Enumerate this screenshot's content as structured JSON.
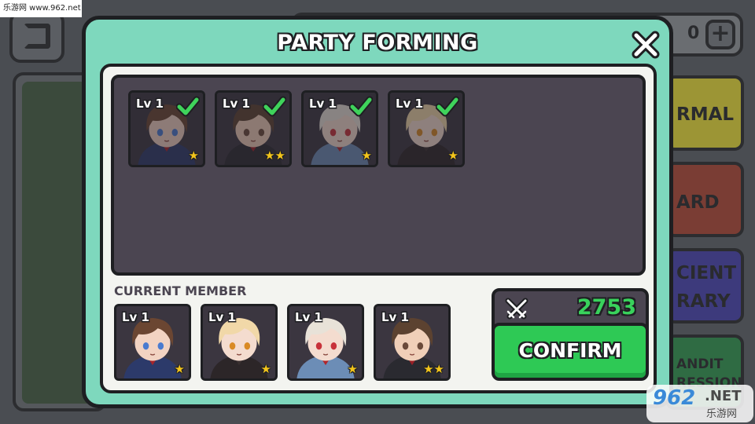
{
  "watermark": {
    "top_text": "乐游网 www.962.net",
    "bottom_number": "962",
    "bottom_net": ".NET",
    "bottom_cn": "乐游网"
  },
  "background": {
    "coin_count": "0",
    "plus_label": "+",
    "modes": [
      {
        "label": "RMAL"
      },
      {
        "label": "ARD"
      },
      {
        "label": "CIENT\nRARY"
      },
      {
        "label": "ANDIT\nRESSION"
      }
    ]
  },
  "modal": {
    "title": "PARTY FORMING",
    "roster": [
      {
        "level": "Lv 1",
        "stars": "★",
        "selected": true,
        "hair": "#6b4632",
        "skin": "#f2d3c2",
        "eye": "#4a7bd0",
        "accent": "#a6242a",
        "outfit": "#2c3a6a"
      },
      {
        "level": "Lv 1",
        "stars": "★★",
        "selected": true,
        "hair": "#5c4230",
        "skin": "#f0cfb8",
        "eye": "#6b4a3a",
        "accent": "#9a1f26",
        "outfit": "#2a2a30"
      },
      {
        "level": "Lv 1",
        "stars": "★",
        "selected": true,
        "hair": "#e8e2d8",
        "skin": "#f4dccf",
        "eye": "#c8323a",
        "accent": "#b0262c",
        "outfit": "#6c8db6"
      },
      {
        "level": "Lv 1",
        "stars": "★",
        "selected": true,
        "hair": "#f1d8a8",
        "skin": "#f4dccf",
        "eye": "#d98a24",
        "accent": "#3a3030",
        "outfit": "#2c2628"
      }
    ],
    "current_label": "CURRENT MEMBER",
    "current_members": [
      {
        "level": "Lv 1",
        "stars": "★",
        "hair": "#6b4632",
        "skin": "#f2d3c2",
        "eye": "#4a7bd0",
        "accent": "#a6242a",
        "outfit": "#2c3a6a"
      },
      {
        "level": "Lv 1",
        "stars": "★",
        "hair": "#f1d8a8",
        "skin": "#f4dccf",
        "eye": "#d98a24",
        "accent": "#3a3030",
        "outfit": "#2c2628"
      },
      {
        "level": "Lv 1",
        "stars": "★",
        "hair": "#e8e2d8",
        "skin": "#f4dccf",
        "eye": "#c8323a",
        "accent": "#b0262c",
        "outfit": "#6c8db6"
      },
      {
        "level": "Lv 1",
        "stars": "★★",
        "hair": "#5c4230",
        "skin": "#f0cfb8",
        "eye": "#6b4a3a",
        "accent": "#9a1f26",
        "outfit": "#2a2a30"
      }
    ],
    "power_value": "2753",
    "confirm_label": "CONFIRM"
  },
  "colors": {
    "modal_bg": "#7ed8bd",
    "roster_bg": "#4b4551",
    "confirm_green": "#2ec955",
    "power_green": "#39d25c",
    "check_green": "#3fd35b",
    "star_gold": "#f3c51b"
  }
}
